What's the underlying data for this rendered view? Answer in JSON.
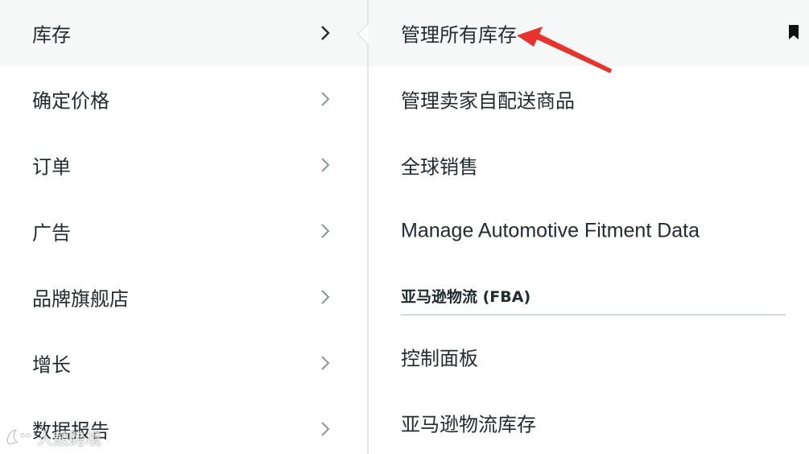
{
  "left_menu": {
    "items": [
      {
        "label": "库存"
      },
      {
        "label": "确定价格"
      },
      {
        "label": "订单"
      },
      {
        "label": "广告"
      },
      {
        "label": "品牌旗舰店"
      },
      {
        "label": "增长"
      },
      {
        "label": "数据报告"
      }
    ],
    "active_index": 0
  },
  "submenu": {
    "items": [
      {
        "label": "管理所有库存"
      },
      {
        "label": "管理卖家自配送商品"
      },
      {
        "label": "全球销售"
      },
      {
        "label": "Manage Automotive Fitment Data"
      }
    ],
    "section": {
      "header": "亚马逊物流 (FBA)",
      "items": [
        {
          "label": "控制面板"
        },
        {
          "label": "亚马逊物流库存"
        }
      ]
    }
  },
  "annotation": {
    "arrow_color": "#e8322b"
  },
  "watermark": {
    "text": "人鼓跨境"
  },
  "colors": {
    "text": "#222c2c",
    "hover_bg": "#f6f7f7",
    "chevron": "#8c9596"
  }
}
